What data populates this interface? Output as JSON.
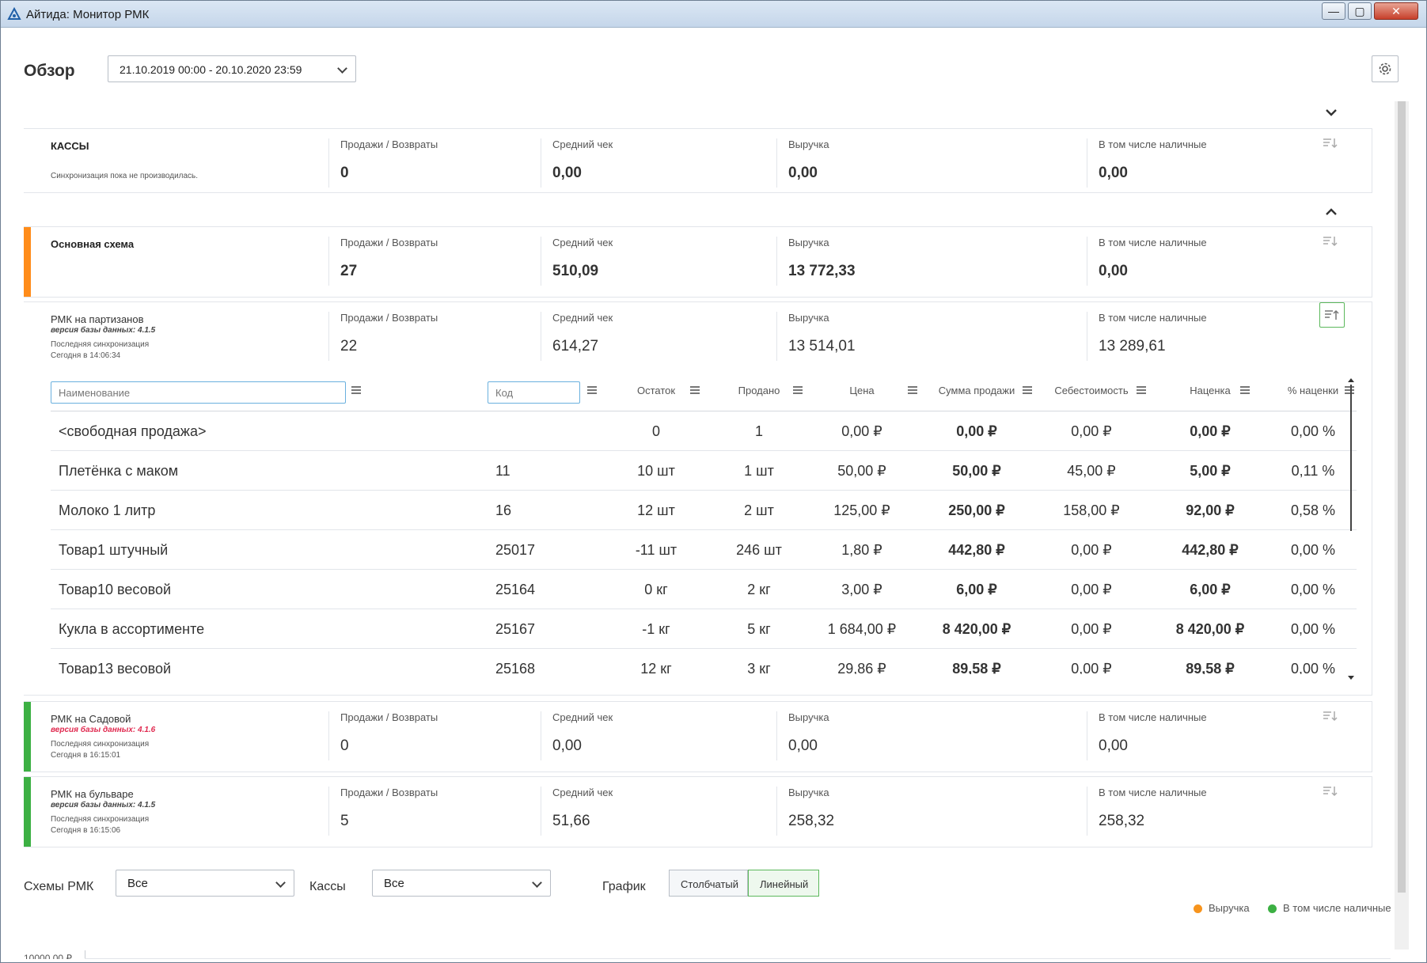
{
  "window": {
    "title": "Айтида: Монитор РМК",
    "minimize": "—",
    "maximize": "▢",
    "close": "✕"
  },
  "header": {
    "title": "Обзор",
    "date_range": "21.10.2019 00:00 - 20.10.2020 23:59"
  },
  "metric_labels": {
    "sales": "Продажи / Возвраты",
    "avg": "Средний чек",
    "revenue": "Выручка",
    "cash": "В том числе наличные"
  },
  "cards": [
    {
      "name": "КАССЫ",
      "note": "Синхронизация пока не производилась.",
      "sales": "0",
      "avg": "0,00",
      "revenue": "0,00",
      "cash": "0,00",
      "stripe": "#ffffff"
    },
    {
      "name": "Основная схема",
      "sales": "27",
      "avg": "510,09",
      "revenue": "13 772,33",
      "cash": "0,00",
      "stripe": "#ff8c1a"
    },
    {
      "name": "РМК на партизанов",
      "db_version": "версия базы данных: 4.1.5",
      "sync_label": "Последняя синхронизация",
      "sync_time": "Сегодня в 14:06:34",
      "sales": "22",
      "avg": "614,27",
      "revenue": "13 514,01",
      "cash": "13 289,61",
      "stripe": "#ffffff"
    },
    {
      "name": "РМК на Садовой",
      "db_version": "версия базы данных: 4.1.6",
      "sync_label": "Последняя синхронизация",
      "sync_time": "Сегодня в 16:15:01",
      "sales": "0",
      "avg": "0,00",
      "revenue": "0,00",
      "cash": "0,00",
      "stripe": "#3cb043"
    },
    {
      "name": "РМК на бульваре",
      "db_version": "версия базы данных: 4.1.5",
      "sync_label": "Последняя синхронизация",
      "sync_time": "Сегодня в 16:15:06",
      "sales": "5",
      "avg": "51,66",
      "revenue": "258,32",
      "cash": "258,32",
      "stripe": "#3cb043"
    }
  ],
  "table": {
    "name_placeholder": "Наименование",
    "code_placeholder": "Код",
    "columns": [
      "Остаток",
      "Продано",
      "Цена",
      "Сумма продажи",
      "Себестоимость",
      "Наценка",
      "% наценки"
    ],
    "rows": [
      {
        "name": "<свободная продажа>",
        "code": "",
        "stock": "0",
        "sold": "1",
        "price": "0,00 ₽",
        "sum": "0,00 ₽",
        "cost": "0,00 ₽",
        "markup": "0,00 ₽",
        "pct": "0,00 %"
      },
      {
        "name": "Плетёнка с маком",
        "code": "11",
        "stock": "10 шт",
        "sold": "1 шт",
        "price": "50,00 ₽",
        "sum": "50,00 ₽",
        "cost": "45,00 ₽",
        "markup": "5,00 ₽",
        "pct": "0,11 %"
      },
      {
        "name": "Молоко 1 литр",
        "code": "16",
        "stock": "12 шт",
        "sold": "2 шт",
        "price": "125,00 ₽",
        "sum": "250,00 ₽",
        "cost": "158,00 ₽",
        "markup": "92,00 ₽",
        "pct": "0,58 %"
      },
      {
        "name": "Товар1 штучный",
        "code": "25017",
        "stock": "-11 шт",
        "sold": "246 шт",
        "price": "1,80 ₽",
        "sum": "442,80 ₽",
        "cost": "0,00 ₽",
        "markup": "442,80 ₽",
        "pct": "0,00 %"
      },
      {
        "name": "Товар10 весовой",
        "code": "25164",
        "stock": "0 кг",
        "sold": "2 кг",
        "price": "3,00 ₽",
        "sum": "6,00 ₽",
        "cost": "0,00 ₽",
        "markup": "6,00 ₽",
        "pct": "0,00 %"
      },
      {
        "name": "Кукла в ассортименте",
        "code": "25167",
        "stock": "-1 кг",
        "sold": "5 кг",
        "price": "1 684,00 ₽",
        "sum": "8 420,00 ₽",
        "cost": "0,00 ₽",
        "markup": "8 420,00 ₽",
        "pct": "0,00 %"
      },
      {
        "name": "Товар13 весовой",
        "code": "25168",
        "stock": "12 кг",
        "sold": "3 кг",
        "price": "29,86 ₽",
        "sum": "89,58 ₽",
        "cost": "0,00 ₽",
        "markup": "89,58 ₽",
        "pct": "0,00 %"
      }
    ]
  },
  "filters": {
    "schemes_label": "Схемы РМК",
    "schemes_value": "Все",
    "registers_label": "Кассы",
    "registers_value": "Все",
    "chart_label": "График",
    "bar_label": "Столбчатый",
    "line_label": "Линейный"
  },
  "legend": {
    "revenue": "Выручка",
    "cash": "В том числе наличные",
    "revenue_color": "#f7941d",
    "cash_color": "#3cb043"
  },
  "axis": {
    "y_top": "10000.00 ₽"
  }
}
